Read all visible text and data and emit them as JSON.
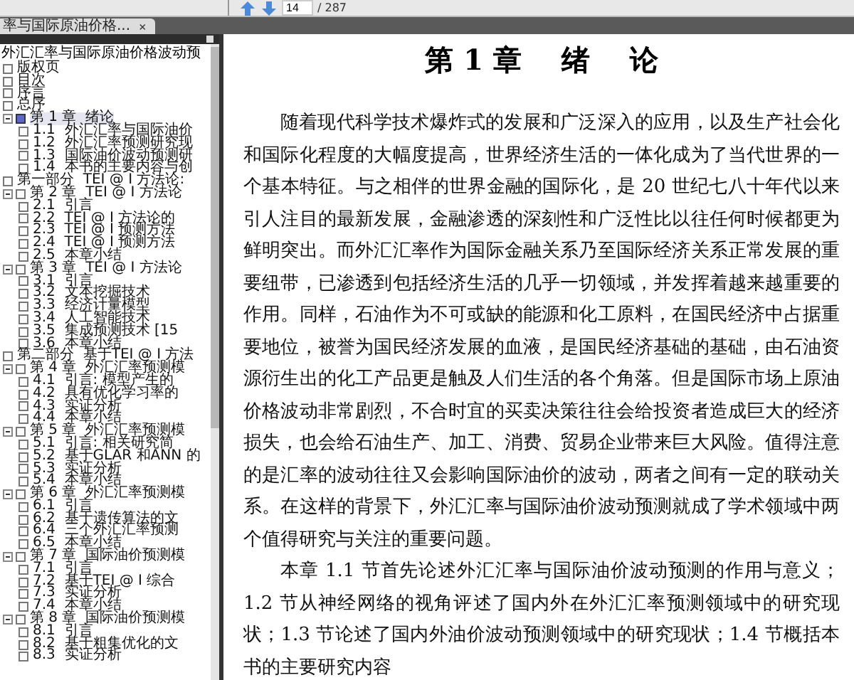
{
  "toolbar": {
    "page_field": {
      "value": "14"
    },
    "page_count": "/ 287"
  },
  "tab": {
    "title": "率与国际原油价格...",
    "close": "×"
  },
  "bookmarks": {
    "title": "外汇汇率与国际原油价格波动预",
    "items": [
      {
        "label": "版权页",
        "selected": false
      },
      {
        "label": "目次",
        "selected": false
      },
      {
        "label": "序言",
        "selected": false
      },
      {
        "label": "总序",
        "selected": false
      },
      {
        "label": "第 1 章  绪论",
        "selected": true,
        "expanded": true,
        "children": [
          {
            "label": "1.1  外汇汇率与国际油价",
            "selected": false
          },
          {
            "label": "1.2  外汇汇率预测研究现",
            "selected": false
          },
          {
            "label": "1.3  国际油价波动预测研",
            "selected": false
          },
          {
            "label": "1.4  本书的主要内容与创",
            "selected": false
          }
        ]
      },
      {
        "label": "第一部分  TEI @ I 方法论:",
        "selected": false
      },
      {
        "label": "第 2 章  TEI @ I 方法论",
        "selected": false,
        "expanded": true,
        "children": [
          {
            "label": "2.1  引言",
            "selected": false
          },
          {
            "label": "2.2  TEI @ I 方法论的",
            "selected": false
          },
          {
            "label": "2.3  TEI @ I 预测方法",
            "selected": false
          },
          {
            "label": "2.4  TEI @ I 预测方法",
            "selected": false
          },
          {
            "label": "2.5  本章小结",
            "selected": false
          }
        ]
      },
      {
        "label": "第 3 章  TEI @ I 方法论",
        "selected": false,
        "expanded": true,
        "children": [
          {
            "label": "3.1  引言",
            "selected": false
          },
          {
            "label": "3.2  文本挖掘技术",
            "selected": false
          },
          {
            "label": "3.3  经济计量模型",
            "selected": false
          },
          {
            "label": "3.4  人工智能技术",
            "selected": false
          },
          {
            "label": "3.5  集成预测技术 [15",
            "selected": false
          },
          {
            "label": "3.6  本章小结",
            "selected": false
          }
        ]
      },
      {
        "label": "第二部分  基于TEI @ I 方法",
        "selected": false
      },
      {
        "label": "第 4 章  外汇汇率预测模",
        "selected": false,
        "expanded": true,
        "children": [
          {
            "label": "4.1  引言: 模型产生的",
            "selected": false
          },
          {
            "label": "4.2  具有优化学习率的",
            "selected": false
          },
          {
            "label": "4.3  实证分析",
            "selected": false
          },
          {
            "label": "4.4  本章小结",
            "selected": false
          }
        ]
      },
      {
        "label": "第 5 章  外汇汇率预测模",
        "selected": false,
        "expanded": true,
        "children": [
          {
            "label": "5.1  引言: 相关研究简",
            "selected": false
          },
          {
            "label": "5.2  基于GLAR 和ANN 的",
            "selected": false
          },
          {
            "label": "5.3  实证分析",
            "selected": false
          },
          {
            "label": "5.4  本章小结",
            "selected": false
          }
        ]
      },
      {
        "label": "第 6 章  外汇汇率预测模",
        "selected": false,
        "expanded": true,
        "children": [
          {
            "label": "6.1  引言",
            "selected": false
          },
          {
            "label": "6.2  基于遗传算法的文",
            "selected": false
          },
          {
            "label": "6.4  三个外汇汇率预测",
            "selected": false
          },
          {
            "label": "6.5  本章小结",
            "selected": false
          }
        ]
      },
      {
        "label": "第 7 章  国际油价预测模",
        "selected": false,
        "expanded": true,
        "children": [
          {
            "label": "7.1  引言",
            "selected": false
          },
          {
            "label": "7.2  基于TEI @ I 综合",
            "selected": false
          },
          {
            "label": "7.3  实证分析",
            "selected": false
          },
          {
            "label": "7.4  本章小结",
            "selected": false
          }
        ]
      },
      {
        "label": "第 8 章  国际油价预测模",
        "selected": false,
        "expanded": true,
        "children": [
          {
            "label": "8.1  引言",
            "selected": false
          },
          {
            "label": "8.2  基于粗集优化的文",
            "selected": false
          },
          {
            "label": "8.3  实证分析",
            "selected": false
          }
        ]
      }
    ]
  },
  "document": {
    "chapter_title": "第 1 章    绪    论",
    "paragraphs": [
      "随着现代科学技术爆炸式的发展和广泛深入的应用，以及生产社会化和国际化程度的大幅度提高，世界经济生活的一体化成为了当代世界的一个基本特征。与之相伴的世界金融的国际化，是 20 世纪七八十年代以来引人注目的最新发展，金融渗透的深刻性和广泛性比以往任何时候都更为鲜明突出。而外汇汇率作为国际金融关系乃至国际经济关系正常发展的重要纽带，已渗透到包括经济生活的几乎一切领域，并发挥着越来越重要的作用。同样，石油作为不可或缺的能源和化工原料，在国民经济中占据重要地位，被誉为国民经济发展的血液，是国民经济基础的基础，由石油资源衍生出的化工产品更是触及人们生活的各个角落。但是国际市场上原油价格波动非常剧烈，不合时宜的买卖决策往往会给投资者造成巨大的经济损失，也会给石油生产、加工、消费、贸易企业带来巨大风险。值得注意的是汇率的波动往往又会影响国际油价的波动，两者之间有一定的联动关系。在这样的背景下，外汇汇率与国际油价波动预测就成了学术领域中两个值得研究与关注的重要问题。",
      "本章 1.1 节首先论述外汇汇率与国际油价波动预测的作用与意义；1.2 节从神经网络的视角评述了国内外在外汇汇率预测领域中的研究现状；1.3 节论述了国内外油价波动预测领域中的研究现状；1.4 节概括本书的主要研究内容"
    ]
  }
}
